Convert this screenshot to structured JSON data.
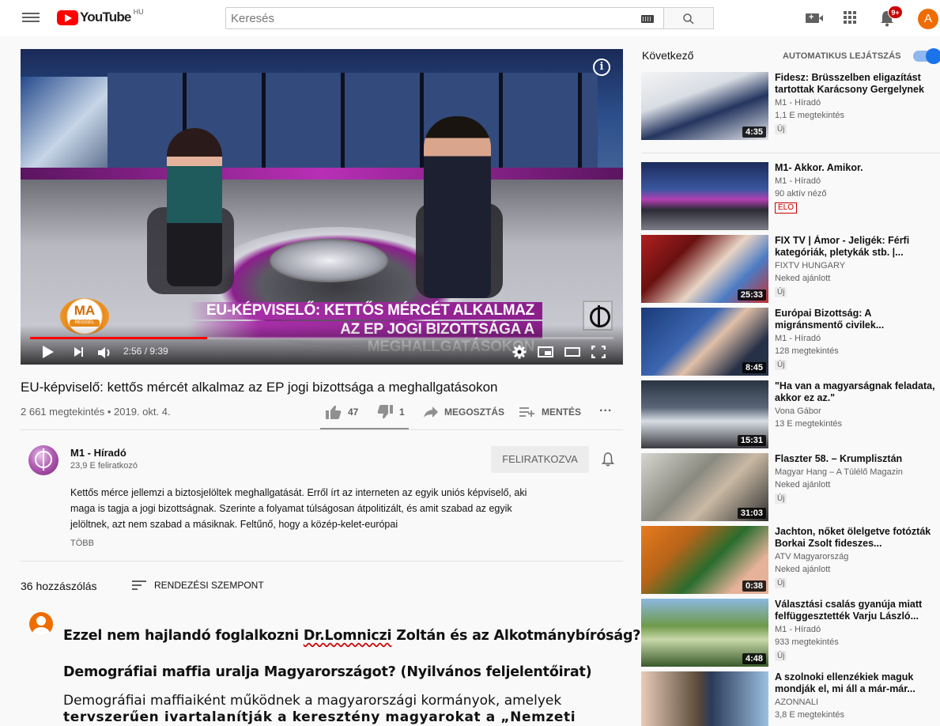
{
  "header": {
    "logo_text": "YouTube",
    "country_code": "HU",
    "search_placeholder": "Keresés",
    "notification_count": "9+",
    "avatar_letter": "A"
  },
  "player": {
    "current_time": "2:56",
    "duration": "9:39",
    "time_display": "2:56 / 9:39",
    "progress": 0.304,
    "overlay_line1": "EU-KÉPVISELŐ: KETTŐS MÉRCÉT ALKALMAZ",
    "overlay_line2": "AZ EP JOGI BIZOTTSÁGA A MEGHALLGATÁSOKON",
    "show_logo_line1": "MA",
    "show_logo_line2": "REGGEL"
  },
  "video": {
    "title": "EU-képviselő: kettős mércét alkalmaz az EP jogi bizottsága a meghallgatásokon",
    "meta": "2 661 megtekintés • 2019. okt. 4.",
    "likes": "47",
    "dislikes": "1",
    "share_label": "MEGOSZTÁS",
    "save_label": "MENTÉS",
    "more_label": "..."
  },
  "channel": {
    "name": "M1 - Híradó",
    "subscribers": "23,9 E feliratkozó",
    "subscribe_label": "FELIRATKOZVA"
  },
  "description": {
    "text": "Kettős mérce jellemzi a biztosjelöltek meghallgatását. Erről írt az interneten az egyik uniós képviselő, aki maga is tagja a jogi bizottságnak. Szerinte a folyamat túlságosan átpolitizált, és amit szabad az egyik jelöltnek, azt nem szabad a másiknak. Feltűnő, hogy a közép-kelet-európai",
    "more_label": "TÖBB"
  },
  "comments": {
    "count_label": "36 hozzászólás",
    "sort_label": "RENDEZÉSI SZEMPONT",
    "heading1_before": "Ezzel nem hajlandó foglalkozni ",
    "heading1_flagged": "Dr.Lomniczi",
    "heading1_after": " Zoltán és az Alkotmánybíróság?",
    "heading2": "Demográfiai maffia uralja Magyarországot? (Nyilvános feljelentőirat)",
    "body_line1": "Demográfiai maffiaiként működnek a magyarországi kormányok, amelyek",
    "body_line2": "tervszerűen ivartalanítják a keresztény magyarokat a „Nemzeti Stop Só"
  },
  "sidebar": {
    "next_label": "Következő",
    "autoplay_label": "AUTOMATIKUS LEJÁTSZÁS",
    "autoplay_on": true,
    "items": [
      {
        "title": "Fidesz: Brüsszelben eligazítást tartottak Karácsony Gergelynek",
        "channel": "M1 - Híradó",
        "views": "1,1 E megtekintés",
        "badge": "Új",
        "duration": "4:35"
      },
      {
        "title": "M1- Akkor. Amikor.",
        "channel": "M1 - Híradó",
        "views": "90 aktív néző",
        "badge": "ÉLŐ",
        "duration": ""
      },
      {
        "title": "FIX TV | Ámor - Jeligék: Férfi kategóriák, pletykák stb. |...",
        "channel": "FIXTV HUNGARY",
        "views": "Neked ajánlott",
        "badge": "Új",
        "duration": "25:33"
      },
      {
        "title": "Európai Bizottság: A migránsmentő civilek...",
        "channel": "M1 - Híradó",
        "views": "128 megtekintés",
        "badge": "Új",
        "duration": "8:45"
      },
      {
        "title": "\"Ha van a magyarságnak feladata, akkor ez az.\"",
        "channel": "Vona Gábor",
        "views": "13 E megtekintés",
        "badge": "",
        "duration": "15:31"
      },
      {
        "title": "Flaszter 58. – Krumplisztán",
        "channel": "Magyar Hang – A Túlélő Magazin",
        "views": "Neked ajánlott",
        "badge": "Új",
        "duration": "31:03"
      },
      {
        "title": "Jachton, nőket ölelgetve fotózták Borkai Zsolt fideszes...",
        "channel": "ATV Magyarország",
        "views": "Neked ajánlott",
        "badge": "Új",
        "duration": "0:38"
      },
      {
        "title": "Választási csalás gyanúja miatt felfüggesztették Varju László...",
        "channel": "M1 - Híradó",
        "views": "933 megtekintés",
        "badge": "Új",
        "duration": "4:48"
      },
      {
        "title": "A szolnoki ellenzékiek maguk mondják el, mi áll a már-már...",
        "channel": "AZONNALI",
        "views": "3,8 E megtekintés",
        "badge": "",
        "duration": ""
      }
    ]
  },
  "colors": {
    "brand_red": "#ff0000",
    "accent_blue": "#1a73e8",
    "overlay_purple": "#a62fa6",
    "show_orange": "#e8891a"
  }
}
